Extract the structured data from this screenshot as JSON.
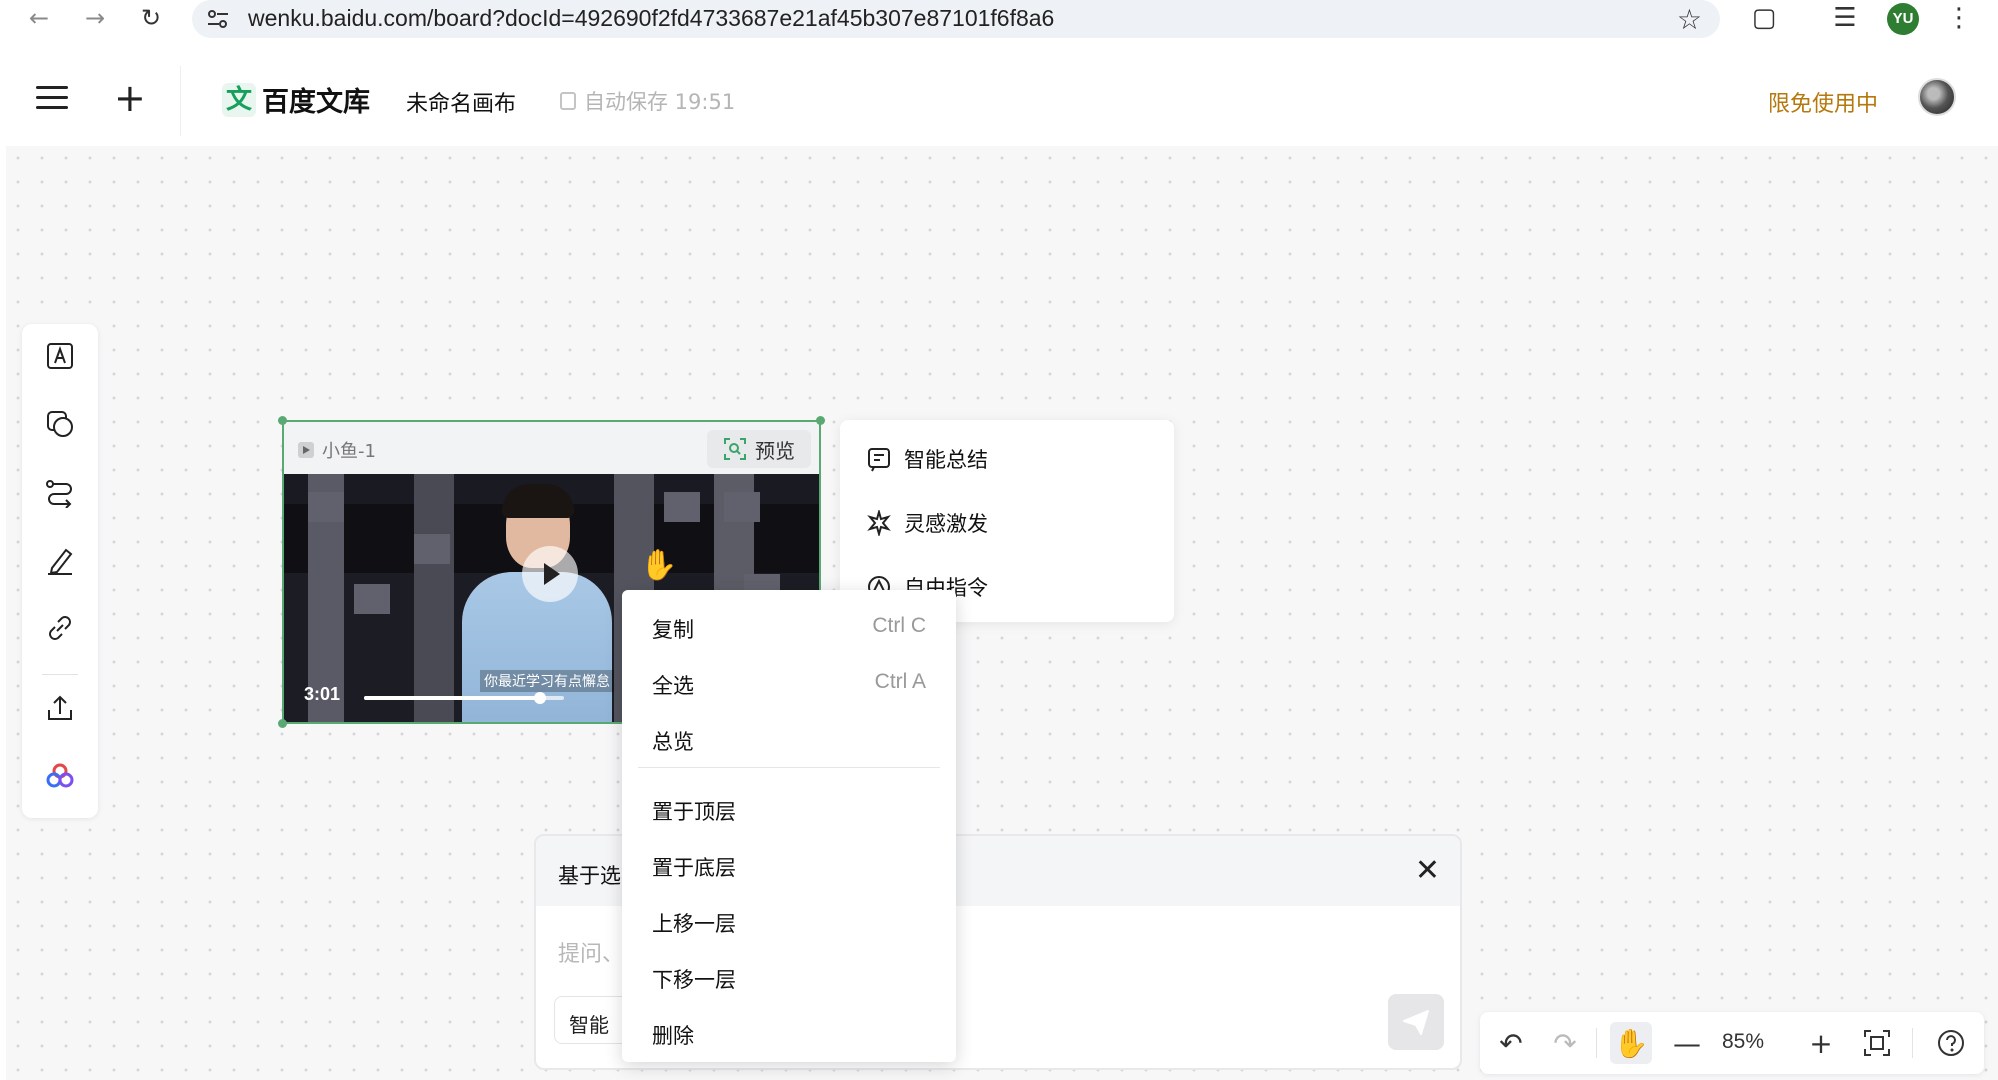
{
  "browser": {
    "url": "wenku.baidu.com/board?docId=492690f2fd4733687e21af45b307e87101f6f8a6",
    "profile_initials": "YU"
  },
  "header": {
    "logo_mark": "文",
    "logo_text": "百度文库",
    "doc_title": "未命名画布",
    "save_status": "自动保存 19:51",
    "free_label": "限免使用中"
  },
  "toolbar": {
    "items": [
      "text-tool-icon",
      "shape-tool-icon",
      "connector-tool-icon",
      "pen-tool-icon",
      "link-tool-icon",
      "upload-tool-icon",
      "ai-apps-icon"
    ]
  },
  "video_card": {
    "title": "小鱼-1",
    "preview_label": "预览",
    "duration": "3:01",
    "subtitle": "你最近学习有点懈怠",
    "progress": 0.88
  },
  "ai_menu": {
    "items": [
      {
        "label": "智能总结",
        "icon": "summary-icon"
      },
      {
        "label": "灵感激发",
        "icon": "inspiration-icon"
      },
      {
        "label": "自由指令",
        "icon": "command-icon"
      }
    ]
  },
  "prompt_panel": {
    "title": "基于选",
    "placeholder": "提问、",
    "chip": "智能",
    "close_icon": "close-icon",
    "send_icon": "send-icon"
  },
  "context_menu": {
    "items": [
      {
        "label": "复制",
        "shortcut": "Ctrl C"
      },
      {
        "label": "全选",
        "shortcut": "Ctrl A"
      },
      {
        "label": "总览",
        "shortcut": ""
      },
      {
        "label": "置于顶层",
        "shortcut": ""
      },
      {
        "label": "置于底层",
        "shortcut": ""
      },
      {
        "label": "上移一层",
        "shortcut": ""
      },
      {
        "label": "下移一层",
        "shortcut": ""
      },
      {
        "label": "删除",
        "shortcut": ""
      }
    ]
  },
  "zoom": {
    "level": "85%"
  },
  "colors": {
    "brand_green": "#17a05d",
    "selection_green": "#5aa972",
    "free_label": "#b5780c"
  }
}
